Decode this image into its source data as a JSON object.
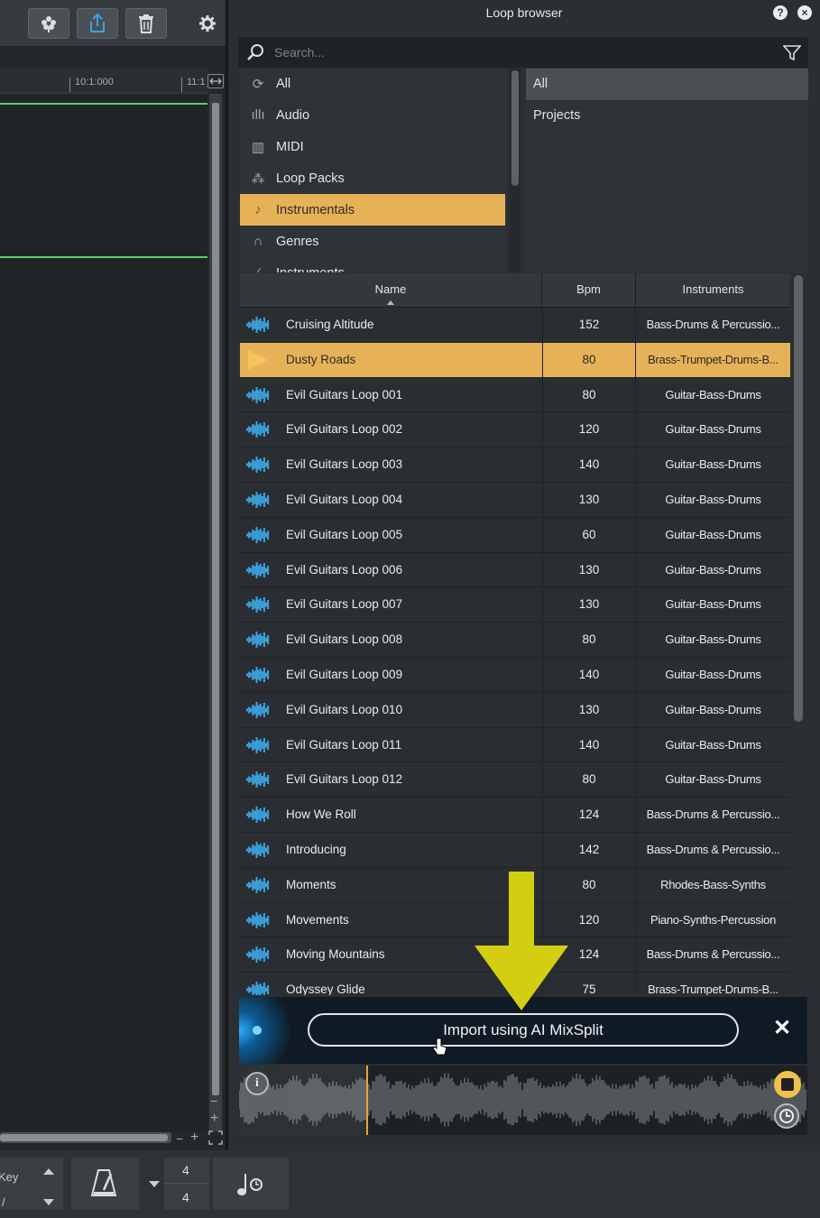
{
  "panel": {
    "title": "Loop browser",
    "help_icon": "?",
    "close_icon": "×"
  },
  "search": {
    "placeholder": "Search..."
  },
  "categories": [
    {
      "label": "All",
      "icon": "refresh-icon",
      "glyph": "⟳"
    },
    {
      "label": "Audio",
      "icon": "audio-wave-icon",
      "glyph": "ıllı"
    },
    {
      "label": "MIDI",
      "icon": "piano-keys-icon",
      "glyph": "▥"
    },
    {
      "label": "Loop Packs",
      "icon": "boxes-icon",
      "glyph": "⁂"
    },
    {
      "label": "Instrumentals",
      "icon": "microphone-icon",
      "glyph": "♪",
      "selected": true
    },
    {
      "label": "Genres",
      "icon": "headphones-icon",
      "glyph": "∩"
    },
    {
      "label": "Instruments",
      "icon": "guitar-icon",
      "glyph": "⁄"
    }
  ],
  "sources": [
    {
      "label": "All",
      "selected": true
    },
    {
      "label": "Projects"
    }
  ],
  "table": {
    "headers": {
      "name": "Name",
      "bpm": "Bpm",
      "instruments": "Instruments"
    },
    "rows": [
      {
        "name": "Cruising Altitude",
        "bpm": "152",
        "instruments": "Bass-Drums & Percussio..."
      },
      {
        "name": "Dusty Roads",
        "bpm": "80",
        "instruments": "Brass-Trumpet-Drums-B...",
        "selected": true
      },
      {
        "name": "Evil Guitars Loop 001",
        "bpm": "80",
        "instruments": "Guitar-Bass-Drums"
      },
      {
        "name": "Evil Guitars Loop 002",
        "bpm": "120",
        "instruments": "Guitar-Bass-Drums"
      },
      {
        "name": "Evil Guitars Loop 003",
        "bpm": "140",
        "instruments": "Guitar-Bass-Drums"
      },
      {
        "name": "Evil Guitars Loop 004",
        "bpm": "130",
        "instruments": "Guitar-Bass-Drums"
      },
      {
        "name": "Evil Guitars Loop 005",
        "bpm": "60",
        "instruments": "Guitar-Bass-Drums"
      },
      {
        "name": "Evil Guitars Loop 006",
        "bpm": "130",
        "instruments": "Guitar-Bass-Drums"
      },
      {
        "name": "Evil Guitars Loop 007",
        "bpm": "130",
        "instruments": "Guitar-Bass-Drums"
      },
      {
        "name": "Evil Guitars Loop 008",
        "bpm": "80",
        "instruments": "Guitar-Bass-Drums"
      },
      {
        "name": "Evil Guitars Loop 009",
        "bpm": "140",
        "instruments": "Guitar-Bass-Drums"
      },
      {
        "name": "Evil Guitars Loop 010",
        "bpm": "130",
        "instruments": "Guitar-Bass-Drums"
      },
      {
        "name": "Evil Guitars Loop 011",
        "bpm": "140",
        "instruments": "Guitar-Bass-Drums"
      },
      {
        "name": "Evil Guitars Loop 012",
        "bpm": "80",
        "instruments": "Guitar-Bass-Drums"
      },
      {
        "name": "How We Roll",
        "bpm": "124",
        "instruments": "Bass-Drums & Percussio..."
      },
      {
        "name": "Introducing",
        "bpm": "142",
        "instruments": "Bass-Drums & Percussio..."
      },
      {
        "name": "Moments",
        "bpm": "80",
        "instruments": "Rhodes-Bass-Synths"
      },
      {
        "name": "Movements",
        "bpm": "120",
        "instruments": "Piano-Synths-Percussion"
      },
      {
        "name": "Moving Mountains",
        "bpm": "124",
        "instruments": "Bass-Drums & Percussio..."
      },
      {
        "name": "Odyssey Glide",
        "bpm": "75",
        "instruments": "Brass-Trumpet-Drums-B..."
      }
    ]
  },
  "mixsplit": {
    "button_label": "Import using AI MixSplit",
    "close_label": "✕"
  },
  "ruler": {
    "mark1": "10:1:000",
    "mark2": "11:1"
  },
  "bottom": {
    "key_label": "Key",
    "slash": "/",
    "time_sig_top": "4",
    "time_sig_bottom": "4",
    "scroll_minus": "−",
    "scroll_plus": "+",
    "vzoom_minus": "−",
    "vzoom_plus": "+"
  },
  "colors": {
    "accent": "#e7b257",
    "arrow": "#d4ce12",
    "waveform_icon": "#3ba3e0",
    "track_line": "#5ecb6a"
  }
}
